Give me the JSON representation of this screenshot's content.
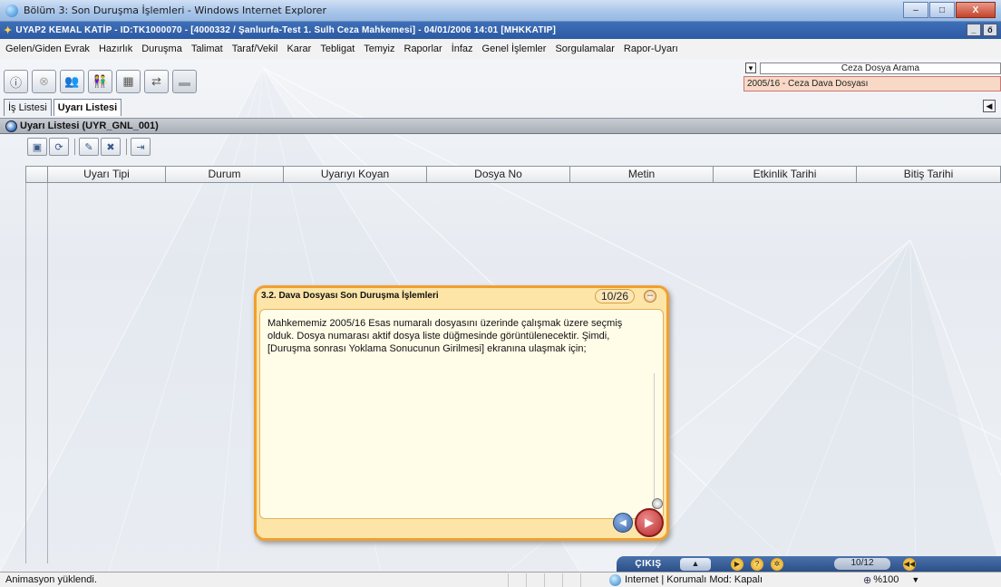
{
  "browser": {
    "title": "Bölüm 3: Son Duruşma İşlemleri - Windows Internet Explorer",
    "minimize": "–",
    "maximize": "□",
    "close": "X"
  },
  "app": {
    "title": "UYAP2  KEMAL KATİP - ID:TK1000070 - [4000332 / Şanlıurfa-Test 1. Sulh Ceza Mahkemesi] - 04/01/2006 14:01 [MHKKATIP]",
    "ctrl_min": "_",
    "ctrl_max": "ő"
  },
  "menu": [
    "Gelen/Giden Evrak",
    "Hazırlık",
    "Duruşma",
    "Talimat",
    "Taraf/Vekil",
    "Karar",
    "Tebligat",
    "Temyiz",
    "Raporlar",
    "İnfaz",
    "Genel İşlemler",
    "Sorgulamalar",
    "Rapor-Uyarı"
  ],
  "search": {
    "label": "Ceza Dosya Arama",
    "case": "2005/16 - Ceza Dava Dosyası"
  },
  "tabs": [
    "İş Listesi",
    "Uyarı Listesi"
  ],
  "panel": {
    "title": "Uyarı Listesi (UYR_GNL_001)"
  },
  "table": {
    "columns": [
      "Uyarı Tipi",
      "Durum",
      "Uyarıyı Koyan",
      "Dosya No",
      "Metin",
      "Etkinlik Tarihi",
      "Bitiş Tarihi"
    ]
  },
  "popup": {
    "title": "3.2. Dava Dosyası Son Duruşma İşlemleri",
    "counter": "10/26",
    "text": "Mahkememiz 2005/16 Esas numaralı dosyasını üzerinde çalışmak üzere seçmiş olduk. Dosya numarası aktif dosya liste düğmesinde görüntülenecektir. Şimdi, [Duruşma sonrası Yoklama Sonucunun Girilmesi] ekranına ulaşmak için;"
  },
  "player": {
    "exit": "ÇIKIŞ",
    "counter": "10/12"
  },
  "status": {
    "text": "Animasyon yüklendi.",
    "zone": "Internet | Korumalı Mod: Kapalı",
    "zoom": "%100"
  },
  "colors": {
    "popup_border": "#f0a030",
    "app_titlebar": "#2c5aa3",
    "case_highlight": "#f7d9c6"
  }
}
